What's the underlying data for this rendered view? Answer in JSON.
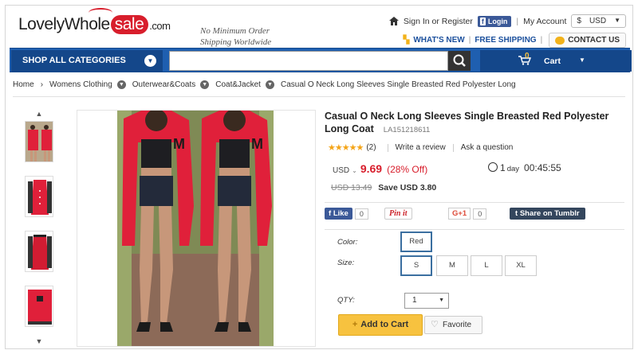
{
  "header": {
    "logo": {
      "part1": "LovelyWhole",
      "part2": "sale",
      "part3": ".com"
    },
    "tagline": [
      "No Minimum Order",
      "Shipping Worldwide"
    ],
    "signin_label": "Sign In or Register",
    "fb_login_label": "Login",
    "my_account_label": "My Account",
    "currency": "USD",
    "whats_new": "WHAT'S NEW",
    "free_shipping": "FREE SHIPPING",
    "contact_us": "CONTACT US"
  },
  "nav": {
    "shop_all": "SHOP ALL CATEGORIES",
    "search_placeholder": "",
    "cart_count": "0",
    "cart_label": "Cart"
  },
  "breadcrumb": [
    "Home",
    "Womens Clothing",
    "Outerwear&Coats",
    "Coat&Jacket",
    "Casual O Neck Long Sleeves Single Breasted Red Polyester Long"
  ],
  "product": {
    "title": "Casual O Neck Long Sleeves Single Breasted Red Polyester Long Coat",
    "sku": "LA151218611",
    "rating_stars": 5,
    "review_count": "(2)",
    "write_review": "Write a review",
    "ask_question": "Ask a question",
    "currency": "USD",
    "price": "9.69",
    "discount": "(28% Off)",
    "timer_days": "1",
    "timer_day_label": "day",
    "timer_time": "00:45:55",
    "old_price": "USD 13.49",
    "save_text": "Save USD 3.80"
  },
  "share": {
    "fb_like": "Like",
    "fb_count": "0",
    "pin": "Pin it",
    "gplus": "G+1",
    "gplus_count": "0",
    "tumblr": "Share on Tumblr"
  },
  "options": {
    "color_label": "Color:",
    "colors": [
      "Red"
    ],
    "size_label": "Size:",
    "sizes": [
      "S",
      "M",
      "L",
      "XL"
    ],
    "qty_label": "QTY:",
    "qty_value": "1",
    "add_to_cart": "Add to Cart",
    "favorite": "Favorite"
  },
  "colors": {
    "brand_red": "#d81e2c",
    "nav_blue": "#1f5fb0",
    "button_yellow": "#f7c23f",
    "coat_red": "#e0203a"
  }
}
